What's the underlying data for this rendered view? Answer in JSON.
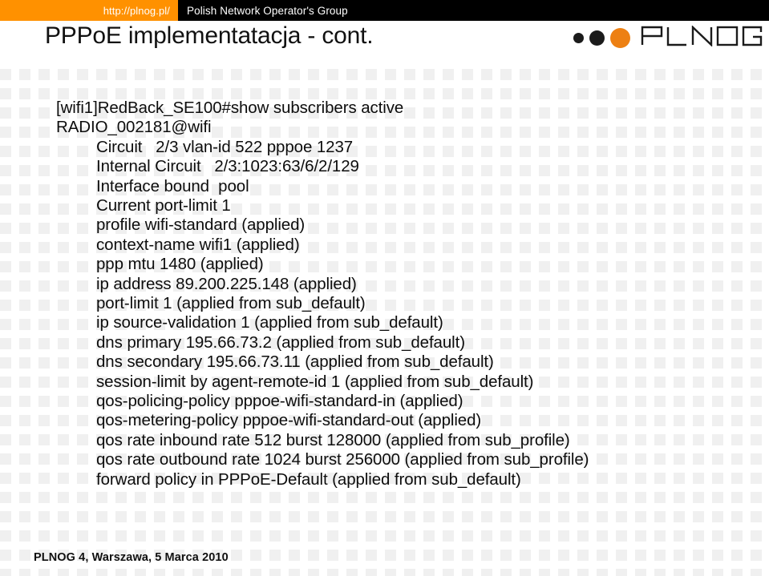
{
  "header": {
    "url": "http://plnog.pl/",
    "tagline": "Polish Network Operator's Group",
    "bar_orange": "#ff9100",
    "bar_black": "#000000"
  },
  "title": "PPPoE implementatacja - cont.",
  "logo": {
    "wordmark": "PLNOG",
    "dot_colors": [
      "#1b1b1b",
      "#1b1b1b",
      "#ed8013"
    ],
    "accent": "#ed8013"
  },
  "terminal": {
    "lines": [
      {
        "text": "[wifi1]RedBack_SE100#show subscribers active",
        "indent": 0
      },
      {
        "text": "RADIO_002181@wifi",
        "indent": 0
      },
      {
        "text": "Circuit   2/3 vlan-id 522 pppoe 1237",
        "indent": 1
      },
      {
        "text": "Internal Circuit   2/3:1023:63/6/2/129",
        "indent": 1
      },
      {
        "text": "Interface bound  pool",
        "indent": 1
      },
      {
        "text": "Current port-limit 1",
        "indent": 1
      },
      {
        "text": "profile wifi-standard (applied)",
        "indent": 1
      },
      {
        "text": "context-name wifi1 (applied)",
        "indent": 1
      },
      {
        "text": "ppp mtu 1480 (applied)",
        "indent": 1
      },
      {
        "text": "ip address 89.200.225.148 (applied)",
        "indent": 1
      },
      {
        "text": "port-limit 1 (applied from sub_default)",
        "indent": 1
      },
      {
        "text": "ip source-validation 1 (applied from sub_default)",
        "indent": 1
      },
      {
        "text": "dns primary 195.66.73.2 (applied from sub_default)",
        "indent": 1
      },
      {
        "text": "dns secondary 195.66.73.11 (applied from sub_default)",
        "indent": 1
      },
      {
        "text": "session-limit by agent-remote-id 1 (applied from sub_default)",
        "indent": 1
      },
      {
        "text": "qos-policing-policy pppoe-wifi-standard-in (applied)",
        "indent": 1
      },
      {
        "text": "qos-metering-policy pppoe-wifi-standard-out (applied)",
        "indent": 1
      },
      {
        "text": "qos rate inbound rate 512 burst 128000 (applied from sub_profile)",
        "indent": 1
      },
      {
        "text": "qos rate outbound rate 1024 burst 256000 (applied from sub_profile)",
        "indent": 1
      },
      {
        "text": "forward policy in PPPoE-Default (applied from sub_default)",
        "indent": 1
      }
    ]
  },
  "footer": {
    "text": "PLNOG 4, Warszawa, 5 Marca 2010"
  }
}
